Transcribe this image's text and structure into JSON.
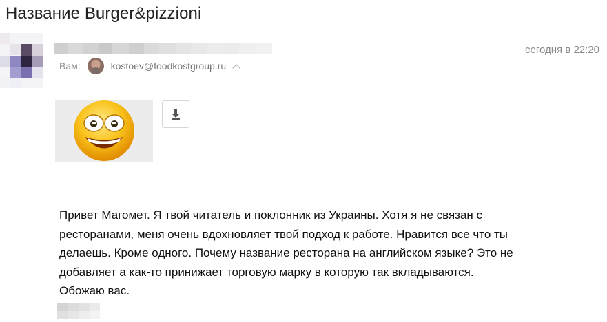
{
  "email": {
    "subject": "Название Burger&pizzioni",
    "date": "сегодня в 22:20",
    "to_label": "Вам:",
    "from_email": "kostoev@foodkostgroup.ru",
    "body": [
      "Привет Магомет. Я твой читатель и поклонник из Украины. Хотя я не связан с",
      "ресторанами, меня очень вдохновляет твой подход к работе. Нравится все что ты",
      "делаешь. Кроме одного. Почему название ресторана на английском языке? Это не",
      "добавляет а как-то принижает торговую марку в которую так вкладываются.",
      "Обожаю вас."
    ]
  },
  "icons": {
    "attachment": "grinning-emoji-icon",
    "download": "download-icon",
    "expand": "chevron-up-icon"
  },
  "colors": {
    "meta_text": "#8a8a8a",
    "attachment_bg": "#ececec",
    "emoji_yellow": "#f5a800"
  }
}
